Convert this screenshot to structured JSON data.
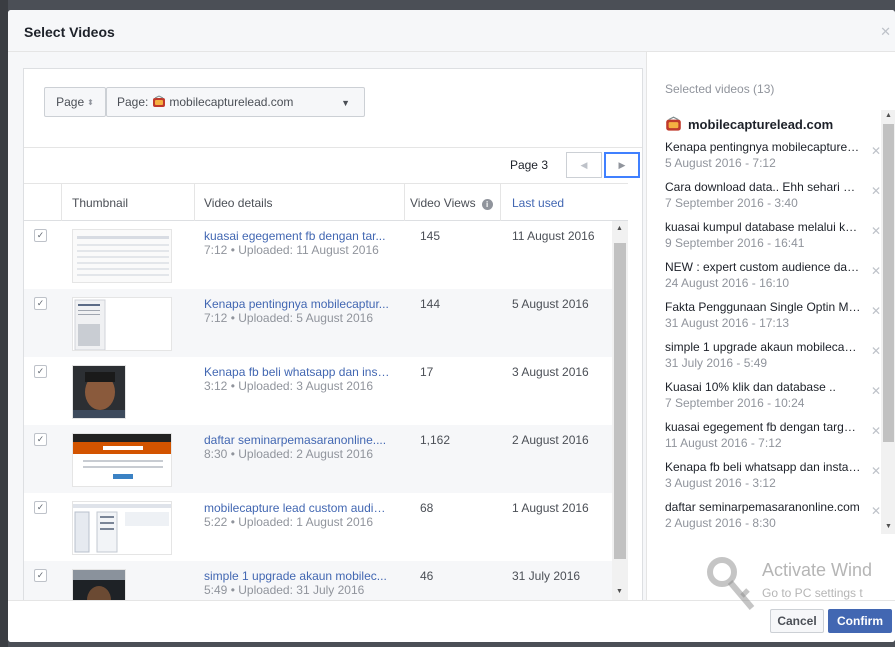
{
  "dialog": {
    "title": "Select Videos",
    "close_glyph": "✕"
  },
  "selectors": {
    "type_label": "Page",
    "type_caret": "⬍",
    "page_prefix": "Page:",
    "page_name": "mobilecapturelead.com",
    "dropdown_glyph": "▼"
  },
  "pager": {
    "label": "Page 3",
    "prev_glyph": "◀",
    "next_glyph": "▶"
  },
  "table": {
    "columns": {
      "thumbnail": "Thumbnail",
      "details": "Video details",
      "views": "Video Views",
      "last_used": "Last used"
    },
    "rows": [
      {
        "title": "kuasai egegement fb dengan tar...",
        "meta": "7:12 • Uploaded: 11 August 2016",
        "views": "145",
        "last_used": "11 August 2016",
        "checked": "✓"
      },
      {
        "title": "Kenapa pentingnya mobilecaptur...",
        "meta": "7:12 • Uploaded: 5 August 2016",
        "views": "144",
        "last_used": "5 August 2016",
        "checked": "✓"
      },
      {
        "title": "Kenapa fb beli whatsapp dan inst...",
        "meta": "3:12 • Uploaded: 3 August 2016",
        "views": "17",
        "last_used": "3 August 2016",
        "checked": "✓"
      },
      {
        "title": "daftar seminarpemasaranonline....",
        "meta": "8:30 • Uploaded: 2 August 2016",
        "views": "1,162",
        "last_used": "2 August 2016",
        "checked": "✓"
      },
      {
        "title": "mobilecapture lead custom audie...",
        "meta": "5:22 • Uploaded: 1 August 2016",
        "views": "68",
        "last_used": "1 August 2016",
        "checked": "✓"
      },
      {
        "title": "simple 1 upgrade akaun mobilec...",
        "meta": "5:49 • Uploaded: 31 July 2016",
        "views": "46",
        "last_used": "31 July 2016",
        "checked": "✓"
      }
    ]
  },
  "selected": {
    "count_label": "Selected videos (13)",
    "page_name": "mobilecapturelead.com",
    "remove_glyph": "✕",
    "items": [
      {
        "title": "Kenapa pentingnya mobilecapturelea...",
        "date": "5 August 2016 - 7:12"
      },
      {
        "title": "Cara download data.. Ehh sehari bu...",
        "date": "7 September 2016 - 3:40"
      },
      {
        "title": "kuasai kumpul database melalui kos li...",
        "date": "9 September 2016 - 16:41"
      },
      {
        "title": "NEW : expert custom audience data ...",
        "date": "24 August 2016 - 16:10"
      },
      {
        "title": "Fakta Penggunaan Single Optin Mob...",
        "date": "31 August 2016 - 17:13"
      },
      {
        "title": "simple 1 upgrade akaun mobilecaptu...",
        "date": "31 July 2016 - 5:49"
      },
      {
        "title": "Kuasai 10% klik dan database ..",
        "date": "7 September 2016 - 10:24"
      },
      {
        "title": "kuasai egegement fb dengan targete...",
        "date": "11 August 2016 - 7:12"
      },
      {
        "title": "Kenapa fb beli whatsapp dan instagr...",
        "date": "3 August 2016 - 3:12"
      },
      {
        "title": "daftar seminarpemasaranonline.com",
        "date": "2 August 2016 - 8:30"
      }
    ]
  },
  "footer": {
    "cancel_label": "Cancel",
    "confirm_label": "Confirm"
  },
  "watermark": {
    "line1": "Activate Wind",
    "line2": "Go to PC settings t"
  },
  "colors": {
    "accent": "#4267b2",
    "link": "#4267b2",
    "focus": "#4080ff"
  }
}
